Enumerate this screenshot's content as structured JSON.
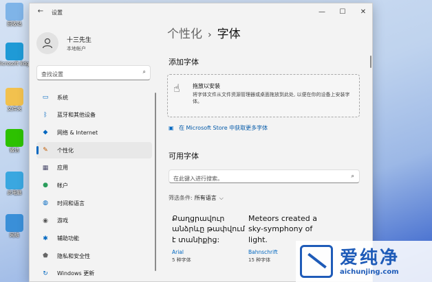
{
  "desktop": {
    "icons": [
      {
        "label": "回收站",
        "icon": "recycle-bin-icon",
        "color": "#7fb4e8"
      },
      {
        "label": "Microsoft Edge",
        "icon": "edge-icon",
        "color": "#1f9ad6"
      },
      {
        "label": "文件夹",
        "icon": "folder-icon",
        "color": "#f2c14e"
      },
      {
        "label": "微信",
        "icon": "wechat-icon",
        "color": "#2dc100"
      },
      {
        "label": "此电脑",
        "icon": "computer-icon",
        "color": "#3aa7e0"
      },
      {
        "label": "网络",
        "icon": "network-icon",
        "color": "#3a8fd8"
      }
    ]
  },
  "window": {
    "app_title": "设置",
    "back_icon": "←",
    "minimize_icon": "—",
    "maximize_icon": "☐",
    "close_icon": "✕"
  },
  "user": {
    "name": "十三先生",
    "account_type": "本地帐户"
  },
  "sidebar": {
    "search_placeholder": "查找设置",
    "items": [
      {
        "label": "系统",
        "icon": "system-icon",
        "glyph": "▭",
        "color": "#0067c0"
      },
      {
        "label": "蓝牙和其他设备",
        "icon": "bluetooth-icon",
        "glyph": "ᛒ",
        "color": "#0067c0"
      },
      {
        "label": "网络 & Internet",
        "icon": "wifi-icon",
        "glyph": "◆",
        "color": "#0067c0"
      },
      {
        "label": "个性化",
        "icon": "brush-icon",
        "glyph": "✎",
        "color": "#c05a00"
      },
      {
        "label": "应用",
        "icon": "apps-icon",
        "glyph": "▦",
        "color": "#4a4a6a"
      },
      {
        "label": "帐户",
        "icon": "account-icon",
        "glyph": "●",
        "color": "#2a9d5b"
      },
      {
        "label": "时间和语言",
        "icon": "globe-clock-icon",
        "glyph": "◍",
        "color": "#0067c0"
      },
      {
        "label": "游戏",
        "icon": "gamepad-icon",
        "glyph": "◉",
        "color": "#555"
      },
      {
        "label": "辅助功能",
        "icon": "accessibility-icon",
        "glyph": "✱",
        "color": "#0067c0"
      },
      {
        "label": "隐私和安全性",
        "icon": "shield-icon",
        "glyph": "⬟",
        "color": "#666"
      },
      {
        "label": "Windows 更新",
        "icon": "update-icon",
        "glyph": "↻",
        "color": "#0067c0"
      }
    ],
    "active_index": 3
  },
  "main": {
    "breadcrumb_parent": "个性化",
    "breadcrumb_separator": "›",
    "breadcrumb_current": "字体",
    "add_fonts_title": "添加字体",
    "drop_title": "拖放以安装",
    "drop_description": "将字体文件从文件资源管理器或桌面拖放到此处, 以便在你的设备上安装字体。",
    "store_link": "在 Microsoft Store 中获取更多字体",
    "available_title": "可用字体",
    "font_search_placeholder": "在此键入进行搜索。",
    "filter_label": "筛选条件:",
    "filter_value": "所有语言",
    "fonts": [
      {
        "preview": "Քաղցրավուր անձրևը թափվում է տանիքից:",
        "name": "Arial",
        "count": "5 种字体"
      },
      {
        "preview": "Meteors created a sky-symphony of light.",
        "name": "Bahnschrift",
        "count": "15 种字体"
      }
    ]
  },
  "watermark": {
    "text": "爱纯净",
    "url": "aichunjing.com"
  }
}
